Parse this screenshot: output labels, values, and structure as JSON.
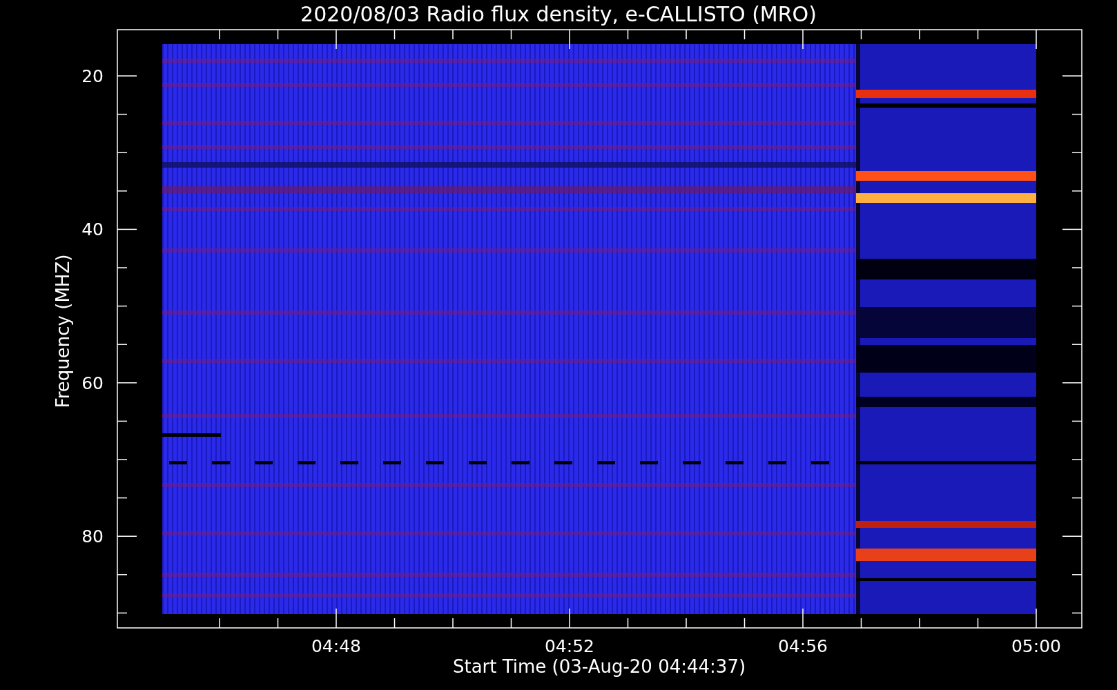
{
  "title": "2020/08/03  Radio flux density, e-CALLISTO (MRO)",
  "y_axis": {
    "label": "Frequency (MHZ)",
    "ticks": [
      {
        "label": "20"
      },
      {
        "label": "40"
      },
      {
        "label": "60"
      },
      {
        "label": "80"
      }
    ]
  },
  "x_axis": {
    "label": "Start Time (03-Aug-20 04:44:37)",
    "ticks": [
      {
        "label": "04:48"
      },
      {
        "label": "04:52"
      },
      {
        "label": "04:56"
      },
      {
        "label": "05:00"
      }
    ]
  }
}
